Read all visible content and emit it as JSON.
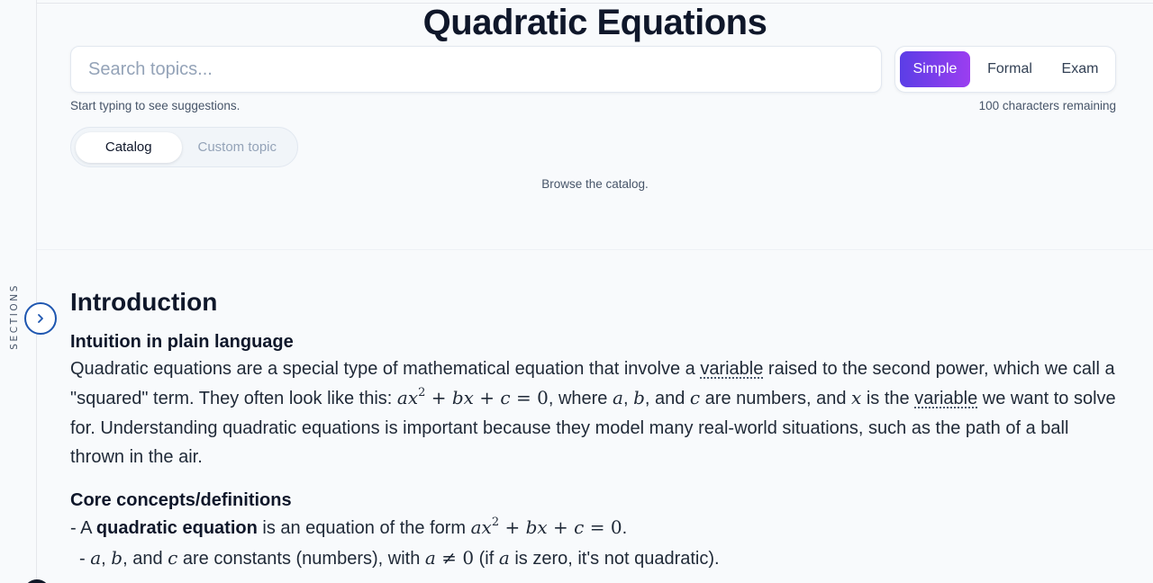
{
  "sidebar": {
    "label": "SECTIONS",
    "toggle_icon": "chevron-right-icon"
  },
  "page": {
    "title": "Quadratic Equations"
  },
  "search": {
    "placeholder": "Search topics...",
    "value": "",
    "hint": "Start typing to see suggestions.",
    "remaining": "100 characters remaining"
  },
  "modes": {
    "selected": "Simple",
    "options": [
      "Simple",
      "Formal",
      "Exam"
    ]
  },
  "source_tabs": {
    "selected": "Catalog",
    "options": [
      "Catalog",
      "Custom topic"
    ],
    "status": "Browse the catalog."
  },
  "colors": {
    "accent_start": "#5b3ee6",
    "accent_end": "#9b3ef0",
    "toggle_border": "#1e56b0"
  },
  "article": {
    "section_title": "Introduction",
    "intuition": {
      "heading": "Intuition in plain language",
      "p1_a": "Quadratic equations are a special type of mathematical equation that involve a ",
      "variable1": "variable",
      "p1_b": " raised to the second power, which we call a \"squared\" term. They often look like this: ",
      "eq": "ax² + bx + c = 0",
      "p1_c": ", where ",
      "v_a": "a",
      "v_b": "b",
      "and_word": ", and ",
      "v_c": "c",
      "p1_d": " are numbers, and ",
      "v_x": "x",
      "p1_e": " is the ",
      "variable2": "variable",
      "p1_f": " we want to solve for. Understanding quadratic equations is important because they model many real-world situations, such as the path of a ball thrown in the air."
    },
    "core": {
      "heading": "Core concepts/definitions",
      "item1_prefix": "- A ",
      "item1_bold": "quadratic equation",
      "item1_mid": " is an equation of the form ",
      "item1_eq": "ax² + bx + c = 0",
      "item1_end": ".",
      "item2_prefix": "- ",
      "item2_mid": " are constants (numbers), with ",
      "item2_cond": "a ≠ 0",
      "item2_paren_a": " (if ",
      "item2_paren_b": " is zero, it's not quadratic)."
    }
  }
}
